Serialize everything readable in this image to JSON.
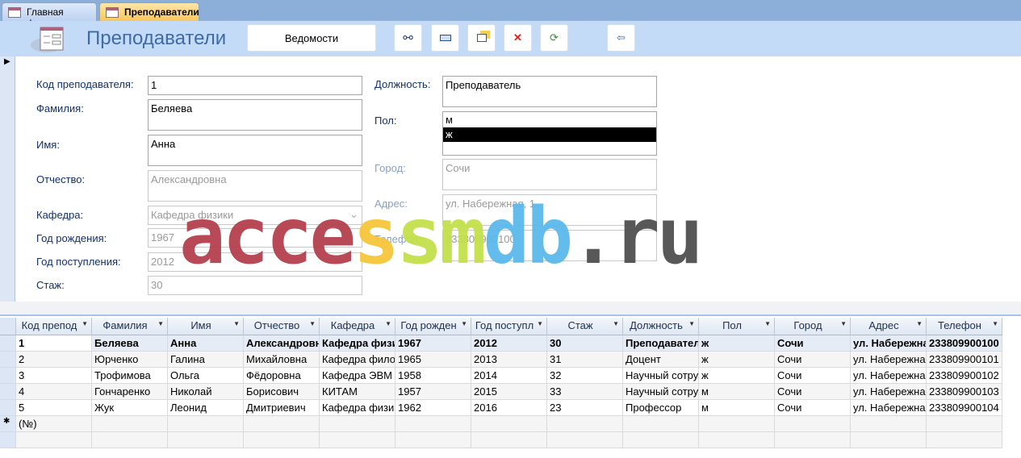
{
  "tabs": [
    {
      "label": "Главная форма",
      "active": false
    },
    {
      "label": "Преподаватели",
      "active": true
    }
  ],
  "header": {
    "title": "Преподаватели",
    "report_button": "Ведомости",
    "toolbar_icons": [
      "find-binoculars-icon",
      "new-record-icon",
      "duplicate-record-icon",
      "delete-record-icon",
      "refresh-icon",
      "exit-door-icon"
    ]
  },
  "form": {
    "left": [
      {
        "label": "Код преподавателя:",
        "value": "1",
        "disabled": false
      },
      {
        "label": "Фамилия:",
        "value": "Беляева",
        "disabled": false
      },
      {
        "label": "Имя:",
        "value": "Анна",
        "disabled": false
      },
      {
        "label": "Отчество:",
        "value": "Александровна",
        "disabled": true
      },
      {
        "label": "Кафедра:",
        "value": "Кафедра физики",
        "disabled": true
      },
      {
        "label": "Год рождения:",
        "value": "1967",
        "disabled": true
      },
      {
        "label": "Год поступления:",
        "value": "2012",
        "disabled": true
      },
      {
        "label": "Стаж:",
        "value": "30",
        "disabled": true
      }
    ],
    "right": [
      {
        "label": "Должность:",
        "value": "Преподаватель"
      },
      {
        "label": "Пол:",
        "options": [
          "м",
          "ж"
        ],
        "selected": "ж"
      },
      {
        "label": "Город:",
        "value": "Сочи"
      },
      {
        "label": "Адрес:",
        "value": "ул. Набережная, 1"
      },
      {
        "label": "Телефон:",
        "value": "233809900100"
      }
    ]
  },
  "watermark": {
    "parts": [
      {
        "text": "acce",
        "color": "#b5414f"
      },
      {
        "text": "s",
        "color": "#f6c63a"
      },
      {
        "text": "s",
        "color": "#c3e04a"
      },
      {
        "text": "m",
        "color": "#c3e04a"
      },
      {
        "text": "db",
        "color": "#5bb9ea"
      },
      {
        "text": ".ru",
        "color": "#505050"
      }
    ]
  },
  "grid": {
    "columns": [
      "Код препод",
      "Фамилия",
      "Имя",
      "Отчество",
      "Кафедра",
      "Год рожден",
      "Год поступл",
      "Стаж",
      "Должность",
      "Пол",
      "Город",
      "Адрес",
      "Телефон"
    ],
    "rows": [
      [
        "1",
        "Беляева",
        "Анна",
        "Александровна",
        "Кафедра физики",
        "1967",
        "2012",
        "30",
        "Преподаватель",
        "ж",
        "Сочи",
        "ул. Набережная",
        "233809900100"
      ],
      [
        "2",
        "Юрченко",
        "Галина",
        "Михайловна",
        "Кафедра филос",
        "1965",
        "2013",
        "31",
        "Доцент",
        "ж",
        "Сочи",
        "ул. Набережная",
        "233809900101"
      ],
      [
        "3",
        "Трофимова",
        "Ольга",
        "Фёдоровна",
        "Кафедра ЭВМ",
        "1958",
        "2014",
        "32",
        "Научный сотрудник",
        "ж",
        "Сочи",
        "ул. Набережная",
        "233809900102"
      ],
      [
        "4",
        "Гончаренко",
        "Николай",
        "Борисович",
        "КИТАМ",
        "1957",
        "2015",
        "33",
        "Научный сотрудник",
        "м",
        "Сочи",
        "ул. Набережная",
        "233809900103"
      ],
      [
        "5",
        "Жук",
        "Леонид",
        "Дмитриевич",
        "Кафедра физики",
        "1962",
        "2016",
        "23",
        "Профессор",
        "м",
        "Сочи",
        "ул. Набережная",
        "233809900104"
      ]
    ],
    "new_row": "(№)"
  }
}
